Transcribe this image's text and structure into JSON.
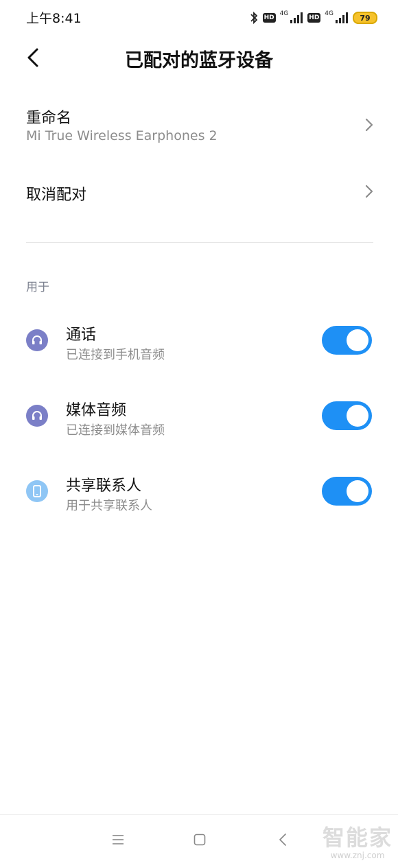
{
  "status_bar": {
    "time": "上午8:41",
    "hd_1": "HD",
    "net_1": "4G",
    "hd_2": "HD",
    "net_2": "4G",
    "battery": "79",
    "battery_color": "#f6c22b"
  },
  "header": {
    "title": "已配对的蓝牙设备",
    "back_icon": "chevron-left-icon"
  },
  "rename": {
    "title": "重命名",
    "device_name": "Mi True Wireless Earphones 2"
  },
  "unpair": {
    "title": "取消配对"
  },
  "section": {
    "label": "用于"
  },
  "features": [
    {
      "title": "通话",
      "subtitle": "已连接到手机音频",
      "icon": "headphones-icon",
      "icon_color": "#7b7fc7",
      "enabled": true
    },
    {
      "title": "媒体音频",
      "subtitle": "已连接到媒体音频",
      "icon": "headphones-icon",
      "icon_color": "#7b7fc7",
      "enabled": true
    },
    {
      "title": "共享联系人",
      "subtitle": "用于共享联系人",
      "icon": "phone-icon",
      "icon_color": "#8fc6f5",
      "enabled": true
    }
  ],
  "colors": {
    "accent": "#1e90f5"
  },
  "nav": {
    "menu_icon": "menu-icon",
    "home_icon": "home-icon",
    "back_icon": "back-icon"
  },
  "watermark": {
    "logo": "智能家",
    "url": "www.znj.com"
  }
}
